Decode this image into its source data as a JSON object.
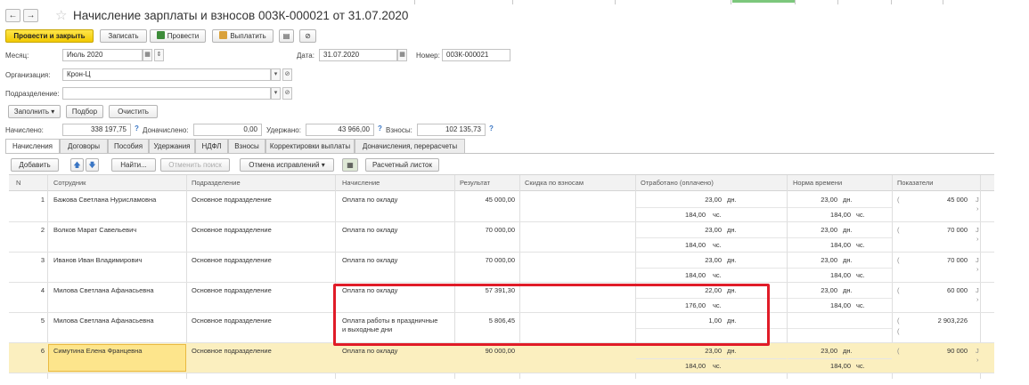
{
  "window": {
    "title": "Начисление зарплаты и взносов 003К-000021 от 31.07.2020",
    "back": "←",
    "forward": "→",
    "star": "☆"
  },
  "toolbar": {
    "post_and_close": "Провести и закрыть",
    "save": "Записать",
    "post": "Провести",
    "pay": "Выплатить"
  },
  "header": {
    "month_label": "Месяц:",
    "month_value": "Июль 2020",
    "date_label": "Дата:",
    "date_value": "31.07.2020",
    "number_label": "Номер:",
    "number_value": "003К-000021",
    "org_label": "Организация:",
    "org_value": "Крон-Ц",
    "dept_label": "Подразделение:",
    "dept_value": ""
  },
  "actions": {
    "fill": "Заполнить",
    "select": "Подбор",
    "clear": "Очистить"
  },
  "totals": {
    "accrued_label": "Начислено:",
    "accrued_value": "338 197,75",
    "extra_label": "Доначислено:",
    "extra_value": "0,00",
    "withheld_label": "Удержано:",
    "withheld_value": "43 966,00",
    "contrib_label": "Взносы:",
    "contrib_value": "102 135,73"
  },
  "tabs": [
    "Начисления",
    "Договоры",
    "Пособия",
    "Удержания",
    "НДФЛ",
    "Взносы",
    "Корректировки выплаты",
    "Доначисления, перерасчеты"
  ],
  "grid_toolbar": {
    "add": "Добавить",
    "find": "Найти...",
    "cancel_search": "Отменить поиск",
    "cancel_corrections": "Отмена исправлений",
    "payslip": "Расчетный листок"
  },
  "columns": {
    "n": "N",
    "employee": "Сотрудник",
    "department": "Подразделение",
    "accrual": "Начисление",
    "result": "Результат",
    "discount": "Скидка по взносам",
    "worked": "Отработано (оплачено)",
    "norm": "Норма времени",
    "indicators": "Показатели"
  },
  "rows": [
    {
      "n": "1",
      "employee": "Бажова Светлана Нурисламовна",
      "department": "Основное подразделение",
      "accrual": "Оплата по окладу",
      "accrual2": "",
      "result": "45 000,00",
      "worked_days": "23,00",
      "worked_days_unit": "дн.",
      "worked_hours": "184,00",
      "worked_hours_unit": "чс.",
      "norm_days": "23,00",
      "norm_days_unit": "дн.",
      "norm_hours": "184,00",
      "norm_hours_unit": "чс.",
      "ind_prefix": "(",
      "ind_prefix2": "",
      "indicator": "45 000",
      "ind_suffix": "J",
      "ind_suffix2": "›"
    },
    {
      "n": "2",
      "employee": "Волков Марат Савельевич",
      "department": "Основное подразделение",
      "accrual": "Оплата по окладу",
      "accrual2": "",
      "result": "70 000,00",
      "worked_days": "23,00",
      "worked_days_unit": "дн.",
      "worked_hours": "184,00",
      "worked_hours_unit": "чс.",
      "norm_days": "23,00",
      "norm_days_unit": "дн.",
      "norm_hours": "184,00",
      "norm_hours_unit": "чс.",
      "ind_prefix": "(",
      "ind_prefix2": "",
      "indicator": "70 000",
      "ind_suffix": "J",
      "ind_suffix2": "›"
    },
    {
      "n": "3",
      "employee": "Иванов Иван Владимирович",
      "department": "Основное подразделение",
      "accrual": "Оплата по окладу",
      "accrual2": "",
      "result": "70 000,00",
      "worked_days": "23,00",
      "worked_days_unit": "дн.",
      "worked_hours": "184,00",
      "worked_hours_unit": "чс.",
      "norm_days": "23,00",
      "norm_days_unit": "дн.",
      "norm_hours": "184,00",
      "norm_hours_unit": "чс.",
      "ind_prefix": "(",
      "ind_prefix2": "",
      "indicator": "70 000",
      "ind_suffix": "J",
      "ind_suffix2": "›"
    },
    {
      "n": "4",
      "employee": "Милова Светлана Афанасьевна",
      "department": "Основное подразделение",
      "accrual": "Оплата по окладу",
      "accrual2": "",
      "result": "57 391,30",
      "worked_days": "22,00",
      "worked_days_unit": "дн.",
      "worked_hours": "176,00",
      "worked_hours_unit": "чс.",
      "norm_days": "23,00",
      "norm_days_unit": "дн.",
      "norm_hours": "184,00",
      "norm_hours_unit": "чс.",
      "ind_prefix": "(",
      "ind_prefix2": "",
      "indicator": "60 000",
      "ind_suffix": "J",
      "ind_suffix2": "›"
    },
    {
      "n": "5",
      "employee": "Милова Светлана Афанасьевна",
      "department": "Основное подразделение",
      "accrual": "Оплата работы в праздничные",
      "accrual2": "и выходные дни",
      "result": "5 806,45",
      "worked_days": "1,00",
      "worked_days_unit": "дн.",
      "worked_hours": "",
      "worked_hours_unit": "",
      "norm_days": "",
      "norm_days_unit": "",
      "norm_hours": "",
      "norm_hours_unit": "",
      "ind_prefix": "(",
      "ind_prefix2": "(",
      "indicator": "2 903,226",
      "ind_suffix": "",
      "ind_suffix2": ""
    },
    {
      "n": "6",
      "employee": "Симутина Елена Францевна",
      "department": "Основное подразделение",
      "accrual": "Оплата по окладу",
      "accrual2": "",
      "result": "90 000,00",
      "worked_days": "23,00",
      "worked_days_unit": "дн.",
      "worked_hours": "184,00",
      "worked_hours_unit": "чс.",
      "norm_days": "23,00",
      "norm_days_unit": "дн.",
      "norm_hours": "184,00",
      "norm_hours_unit": "чс.",
      "ind_prefix": "(",
      "ind_prefix2": "",
      "indicator": "90 000",
      "ind_suffix": "J",
      "ind_suffix2": "›"
    }
  ],
  "colors": {
    "primary_button": "#f2c900",
    "selected_row": "#fbefbf",
    "highlight_box": "#e01c28",
    "accent": "#3a76c4"
  }
}
